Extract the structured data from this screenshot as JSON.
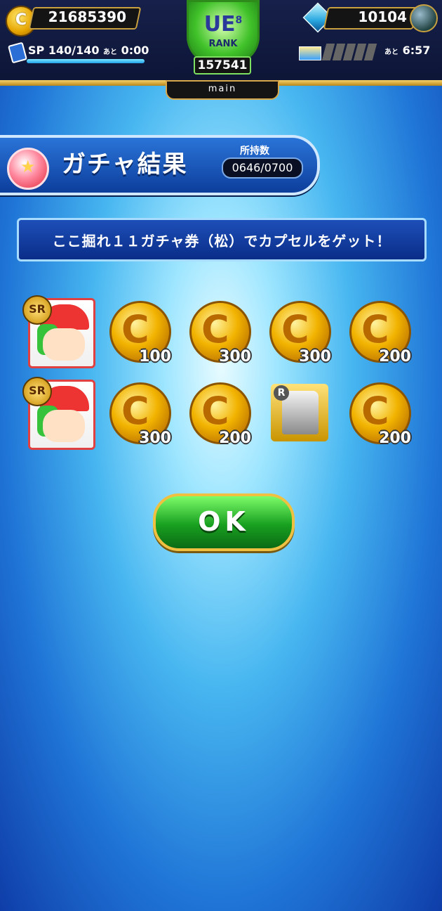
{
  "top_bar": {
    "coins": "21685390",
    "coin_glyph": "C",
    "gems": "10104",
    "sp_label": "SP",
    "sp_value": "140/140",
    "sp_suffix": "あと",
    "sp_time": "0:00",
    "sp_fill_fraction": 1.0,
    "stamina_suffix": "あと",
    "stamina_time": "6:57",
    "rank": {
      "badge_text": "UE",
      "badge_number": "8",
      "label": "RANK",
      "value": "157541"
    },
    "mode_tab": "main"
  },
  "header": {
    "title": "ガチャ結果",
    "owned_label": "所持数",
    "owned_value": "0646/0700"
  },
  "banner_message": "ここ掘れ１１ガチャ券（松）でカプセルをゲット！",
  "results": [
    {
      "type": "character",
      "rarity": "SR"
    },
    {
      "type": "coin",
      "amount": "100"
    },
    {
      "type": "coin",
      "amount": "300"
    },
    {
      "type": "coin",
      "amount": "300"
    },
    {
      "type": "coin",
      "amount": "200"
    },
    {
      "type": "character",
      "rarity": "SR"
    },
    {
      "type": "coin",
      "amount": "300"
    },
    {
      "type": "coin",
      "amount": "200"
    },
    {
      "type": "trophy",
      "rarity": "R"
    },
    {
      "type": "coin",
      "amount": "200"
    }
  ],
  "ok_button": "OK",
  "colors": {
    "top_bar": "#0d1536",
    "gold_trim": "#d9a84a",
    "header_blue": "#0d3e9c",
    "ok_green": "#18a020"
  }
}
